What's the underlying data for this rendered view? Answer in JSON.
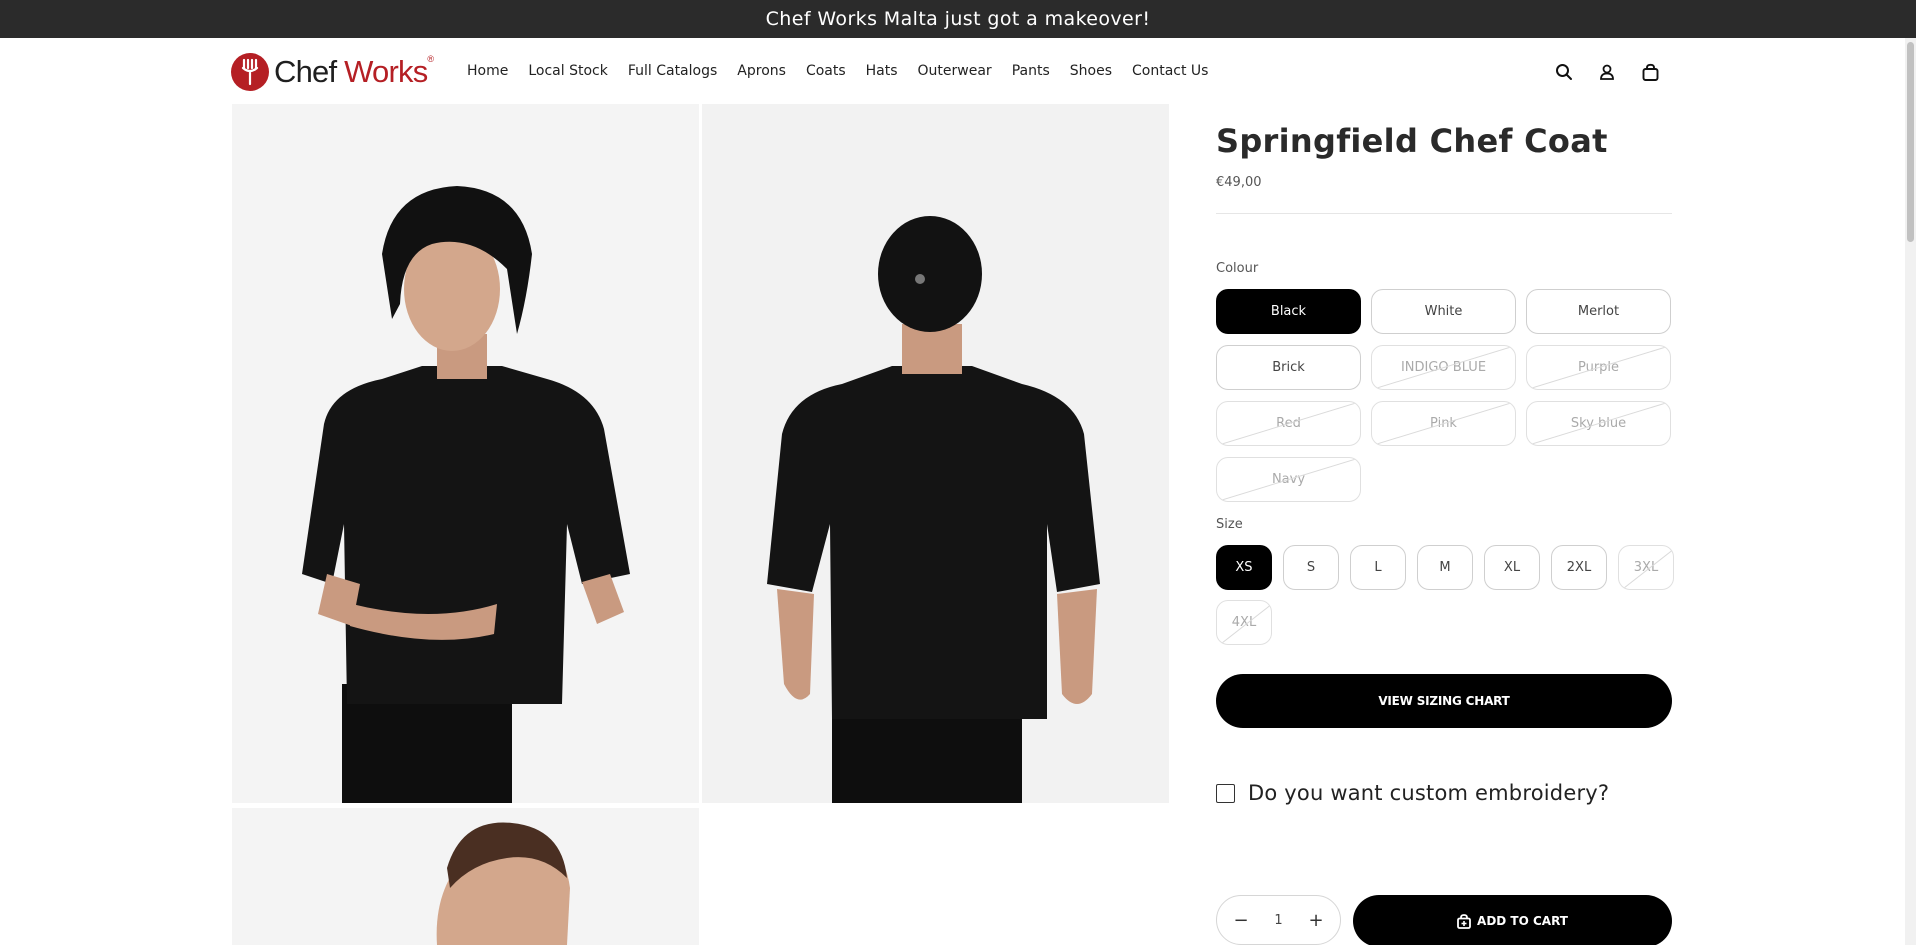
{
  "announcement": {
    "text": "Chef Works Malta just got a makeover!"
  },
  "header": {
    "logo": {
      "word1": "Chef",
      "word2": "Works",
      "mark": "®"
    },
    "nav": [
      "Home",
      "Local Stock",
      "Full Catalogs",
      "Aprons",
      "Coats",
      "Hats",
      "Outerwear",
      "Pants",
      "Shoes",
      "Contact Us"
    ],
    "icons": [
      "search-icon",
      "account-icon",
      "cart-icon"
    ]
  },
  "product": {
    "title": "Springfield Chef Coat",
    "price": "€49,00",
    "colour_label": "Colour",
    "colours": [
      {
        "label": "Black",
        "state": "selected"
      },
      {
        "label": "White",
        "state": "available"
      },
      {
        "label": "Merlot",
        "state": "available"
      },
      {
        "label": "Brick",
        "state": "available"
      },
      {
        "label": "INDIGO BLUE",
        "state": "disabled"
      },
      {
        "label": "Purple",
        "state": "disabled"
      },
      {
        "label": "Red",
        "state": "disabled"
      },
      {
        "label": "Pink",
        "state": "disabled"
      },
      {
        "label": "Sky blue",
        "state": "disabled"
      },
      {
        "label": "Navy",
        "state": "disabled"
      }
    ],
    "size_label": "Size",
    "sizes": [
      {
        "label": "XS",
        "state": "selected"
      },
      {
        "label": "S",
        "state": "available"
      },
      {
        "label": "L",
        "state": "available"
      },
      {
        "label": "M",
        "state": "available"
      },
      {
        "label": "XL",
        "state": "available"
      },
      {
        "label": "2XL",
        "state": "available"
      },
      {
        "label": "3XL",
        "state": "disabled"
      },
      {
        "label": "4XL",
        "state": "disabled"
      }
    ],
    "sizing_button": "VIEW SIZING CHART",
    "embroidery_label": "Do you want custom embroidery?",
    "quantity": "1",
    "qty_minus": "−",
    "qty_plus": "+",
    "add_to_cart": "ADD TO CART"
  },
  "colors": {
    "brand_red": "#b51f24",
    "announcement_bg": "#2b2b2b",
    "button_bg": "#000000"
  }
}
